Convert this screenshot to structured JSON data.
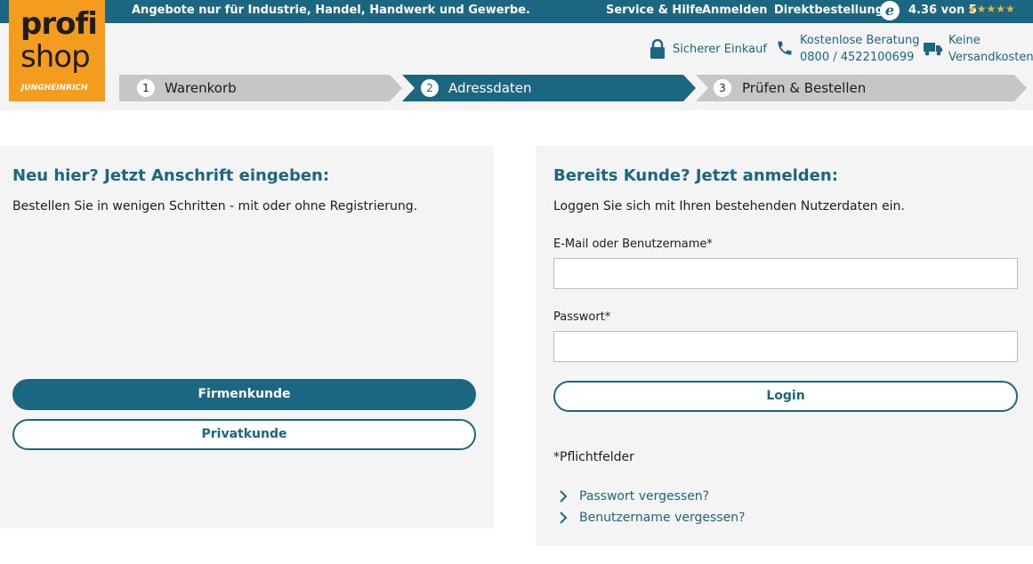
{
  "topbar": {
    "promo": "Angebote nur für Industrie, Handel, Handwerk und Gewerbe.",
    "nav": [
      "Service & Hilfe",
      "Anmelden",
      "Direktbestellung"
    ],
    "trusted_letter": "e",
    "rating": "4.36 von 5",
    "stars": "★★★★★"
  },
  "logo": {
    "line1": "profi",
    "line2": "shop",
    "brand": "JUNGHEINRICH"
  },
  "usps": {
    "secure": "Sicherer Einkauf",
    "consult_title": "Kostenlose Beratung",
    "consult_phone": "0800 / 4522100699",
    "shipping_line1": "Keine",
    "shipping_line2": "Versandkosten"
  },
  "steps": [
    {
      "num": "1",
      "label": "Warenkorb"
    },
    {
      "num": "2",
      "label": "Adressdaten"
    },
    {
      "num": "3",
      "label": "Prüfen & Bestellen"
    }
  ],
  "new_customer": {
    "title": "Neu hier? Jetzt Anschrift eingeben:",
    "subtitle": "Bestellen Sie in wenigen Schritten - mit oder ohne Registrierung.",
    "company_button": "Firmenkunde",
    "private_button": "Privatkunde"
  },
  "existing_customer": {
    "title": "Bereits Kunde? Jetzt anmelden:",
    "subtitle": "Loggen Sie sich mit Ihren bestehenden Nutzerdaten ein.",
    "email_label": "E-Mail oder Benutzername*",
    "email_value": "",
    "password_label": "Passwort*",
    "password_value": "",
    "login_button": "Login",
    "required_note": "*Pflichtfelder",
    "forgot_password": "Passwort vergessen?",
    "forgot_username": "Benutzername vergessen?"
  },
  "colors": {
    "brand_blue": "#1b6680",
    "logo_orange": "#f39c1e",
    "star_gold": "#f3b331",
    "step_inactive": "#c6c6c6"
  }
}
